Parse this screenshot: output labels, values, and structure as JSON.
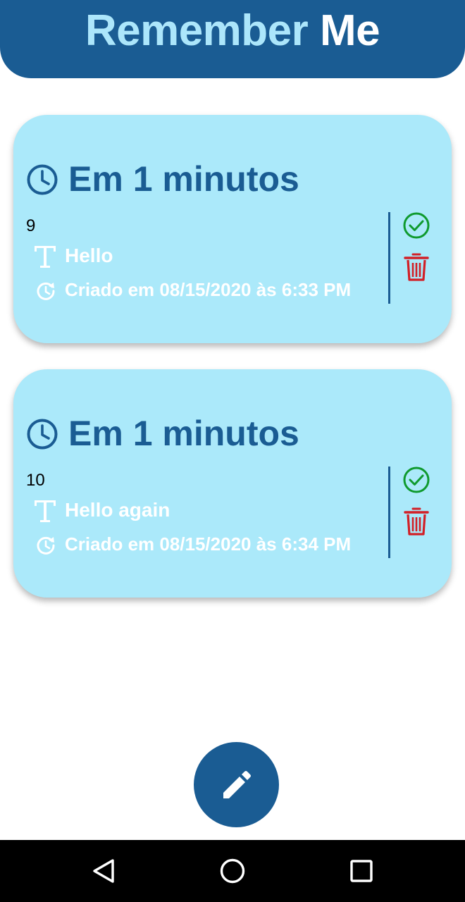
{
  "header": {
    "title_part1": "Remember",
    "title_part2": "Me"
  },
  "reminders": [
    {
      "due": "Em 1 minutos",
      "id": "9",
      "text": "Hello",
      "created": "Criado em 08/15/2020 às 6:33 PM"
    },
    {
      "due": "Em 1 minutos",
      "id": "10",
      "text": "Hello again",
      "created": "Criado em 08/15/2020 às 6:34 PM"
    }
  ],
  "icons": {
    "clock": "clock-icon",
    "text": "text-format-icon",
    "history": "history-icon",
    "complete": "check-circle-icon",
    "delete": "trash-icon",
    "fab": "pencil-icon"
  },
  "colors": {
    "primary": "#1a5c93",
    "card": "#abe9fa",
    "title_accent": "#ace6fb",
    "check": "#0f9a2e",
    "delete": "#d21f26"
  }
}
